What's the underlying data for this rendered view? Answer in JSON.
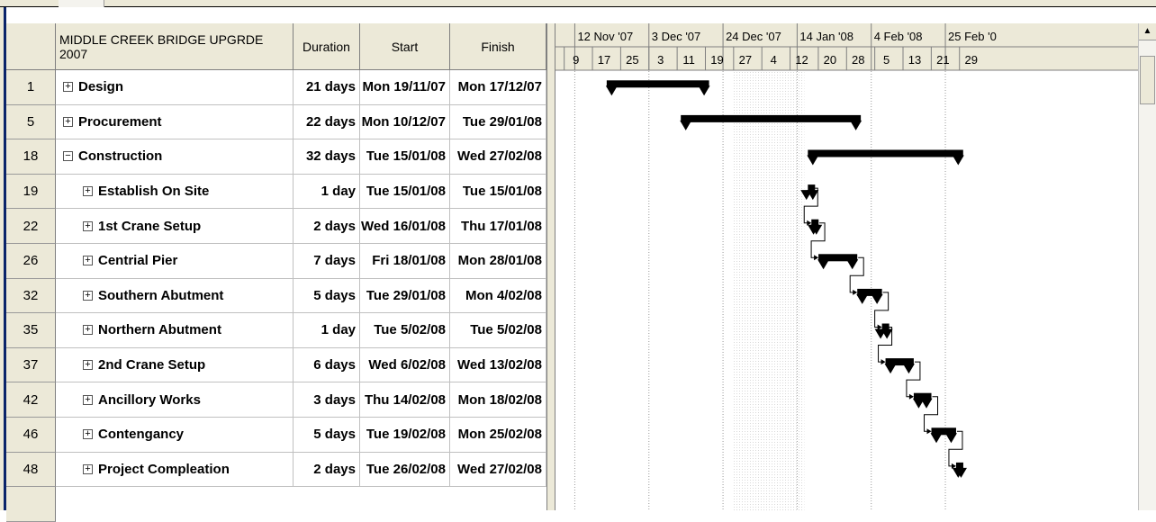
{
  "table": {
    "headers": {
      "id": "",
      "name": "MIDDLE CREEK BRIDGE UPGRDE 2007",
      "duration": "Duration",
      "start": "Start",
      "finish": "Finish"
    },
    "rows": [
      {
        "id": "1",
        "name": "Design",
        "toggle": "+",
        "indent": 0,
        "duration": "21 days",
        "start": "Mon 19/11/07",
        "finish": "Mon 17/12/07"
      },
      {
        "id": "5",
        "name": "Procurement",
        "toggle": "+",
        "indent": 0,
        "duration": "22 days",
        "start": "Mon 10/12/07",
        "finish": "Tue 29/01/08"
      },
      {
        "id": "18",
        "name": "Construction",
        "toggle": "−",
        "indent": 0,
        "duration": "32 days",
        "start": "Tue 15/01/08",
        "finish": "Wed 27/02/08"
      },
      {
        "id": "19",
        "name": "Establish On Site",
        "toggle": "+",
        "indent": 1,
        "duration": "1 day",
        "start": "Tue 15/01/08",
        "finish": "Tue 15/01/08"
      },
      {
        "id": "22",
        "name": "1st Crane Setup",
        "toggle": "+",
        "indent": 1,
        "duration": "2 days",
        "start": "Wed 16/01/08",
        "finish": "Thu 17/01/08"
      },
      {
        "id": "26",
        "name": "Centrial Pier",
        "toggle": "+",
        "indent": 1,
        "duration": "7 days",
        "start": "Fri 18/01/08",
        "finish": "Mon 28/01/08"
      },
      {
        "id": "32",
        "name": "Southern Abutment",
        "toggle": "+",
        "indent": 1,
        "duration": "5 days",
        "start": "Tue 29/01/08",
        "finish": "Mon 4/02/08"
      },
      {
        "id": "35",
        "name": "Northern Abutment",
        "toggle": "+",
        "indent": 1,
        "duration": "1 day",
        "start": "Tue 5/02/08",
        "finish": "Tue 5/02/08"
      },
      {
        "id": "37",
        "name": "2nd Crane Setup",
        "toggle": "+",
        "indent": 1,
        "duration": "6 days",
        "start": "Wed 6/02/08",
        "finish": "Wed 13/02/08"
      },
      {
        "id": "42",
        "name": "Ancillory Works",
        "toggle": "+",
        "indent": 1,
        "duration": "3 days",
        "start": "Thu 14/02/08",
        "finish": "Mon 18/02/08"
      },
      {
        "id": "46",
        "name": "Contengancy",
        "toggle": "+",
        "indent": 1,
        "duration": "5 days",
        "start": "Tue 19/02/08",
        "finish": "Mon 25/02/08"
      },
      {
        "id": "48",
        "name": "Project Compleation",
        "toggle": "+",
        "indent": 1,
        "duration": "2 days",
        "start": "Tue 26/02/08",
        "finish": "Wed 27/02/08"
      }
    ]
  },
  "timescale": {
    "major": [
      "12 Nov '07",
      "3 Dec '07",
      "24 Dec '07",
      "14 Jan '08",
      "4 Feb '08",
      "25 Feb '0"
    ],
    "minor": [
      "9",
      "17",
      "25",
      "3",
      "11",
      "19",
      "27",
      "4",
      "12",
      "20",
      "28",
      "5",
      "13",
      "21",
      "29"
    ]
  },
  "gantt_bars": [
    {
      "task": "1",
      "start": "2007-11-19",
      "finish": "2007-12-17",
      "summary": true
    },
    {
      "task": "5",
      "start": "2007-12-10",
      "finish": "2008-01-29",
      "summary": true
    },
    {
      "task": "18",
      "start": "2008-01-15",
      "finish": "2008-02-27",
      "summary": true
    },
    {
      "task": "19",
      "start": "2008-01-15",
      "finish": "2008-01-15",
      "summary": true
    },
    {
      "task": "22",
      "start": "2008-01-16",
      "finish": "2008-01-17",
      "summary": true
    },
    {
      "task": "26",
      "start": "2008-01-18",
      "finish": "2008-01-28",
      "summary": true
    },
    {
      "task": "32",
      "start": "2008-01-29",
      "finish": "2008-02-04",
      "summary": true
    },
    {
      "task": "35",
      "start": "2008-02-05",
      "finish": "2008-02-05",
      "summary": true
    },
    {
      "task": "37",
      "start": "2008-02-06",
      "finish": "2008-02-13",
      "summary": true
    },
    {
      "task": "42",
      "start": "2008-02-14",
      "finish": "2008-02-18",
      "summary": true
    },
    {
      "task": "46",
      "start": "2008-02-19",
      "finish": "2008-02-25",
      "summary": true
    },
    {
      "task": "48",
      "start": "2008-02-26",
      "finish": "2008-02-27",
      "summary": true
    }
  ],
  "nonworking_shading": {
    "start": "2007-12-25",
    "finish": "2008-01-14"
  },
  "colors": {
    "bar": "#000000",
    "header_bg": "#ece9d8",
    "selection_blue": "#0a246a",
    "shading": "#d9d9d9"
  }
}
